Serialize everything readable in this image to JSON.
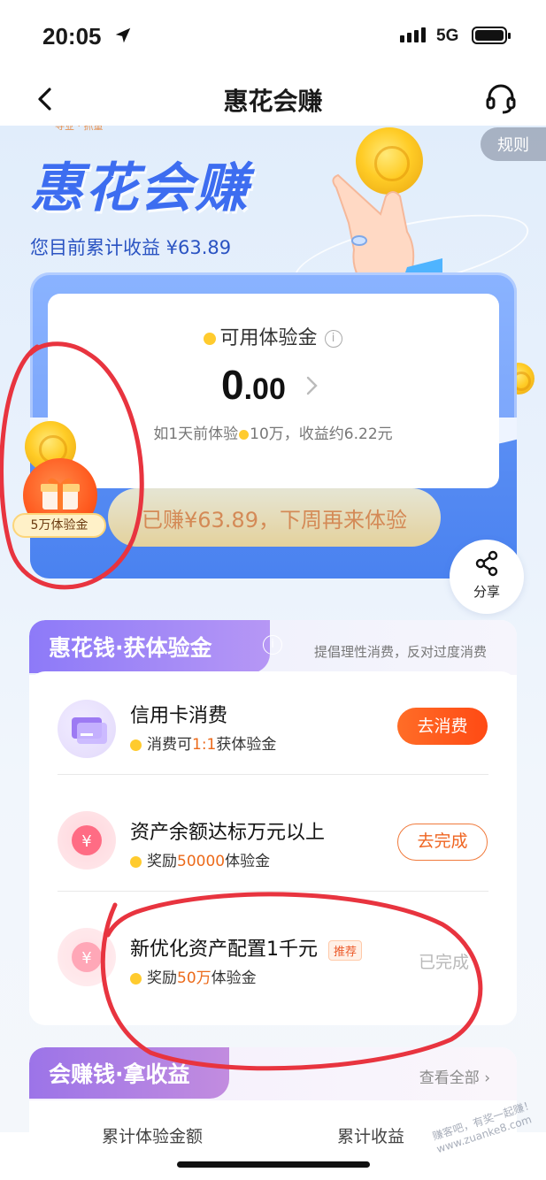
{
  "status_bar": {
    "time": "20:05",
    "network": "5G"
  },
  "nav": {
    "title": "惠花会赚"
  },
  "hero": {
    "deco_top": "寻业 · 抓量",
    "title": "惠花会赚",
    "subtitle": "您目前累计收益 ¥63.89",
    "rules_label": "规则"
  },
  "card": {
    "label": "可用体验金",
    "value_int": "0",
    "value_dec": ".00",
    "hint_prefix": "如1天前体验",
    "hint_suffix": "10万，收益约6.22元",
    "earned_button": "已赚¥63.89，下周再来体验",
    "gift_tag": "5万体验金",
    "share_label": "分享"
  },
  "section1": {
    "title": "惠花钱·获体验金",
    "note": "提倡理性消费，反对过度消费",
    "tasks": [
      {
        "title": "信用卡消费",
        "sub_pre": "消费可",
        "sub_hl": "1:1",
        "sub_post": "获体验金",
        "action": "去消费"
      },
      {
        "title": "资产余额达标万元以上",
        "sub_pre": "奖励",
        "sub_hl": "50000",
        "sub_post": "体验金",
        "action": "去完成"
      },
      {
        "title": "新优化资产配置1千元",
        "badge": "推荐",
        "sub_pre": "奖励",
        "sub_hl": "50万",
        "sub_post": "体验金",
        "action": "已完成"
      }
    ]
  },
  "section2": {
    "title": "会赚钱·拿收益",
    "more": "查看全部",
    "col1": "累计体验金额",
    "col2": "累计收益"
  },
  "watermark": "赚客吧，有奖一起赚！ www.zuanke8.com",
  "colors": {
    "accent_blue": "#3d6df0",
    "orange": "#ff5a1f",
    "annotation_red": "#e8343f"
  }
}
